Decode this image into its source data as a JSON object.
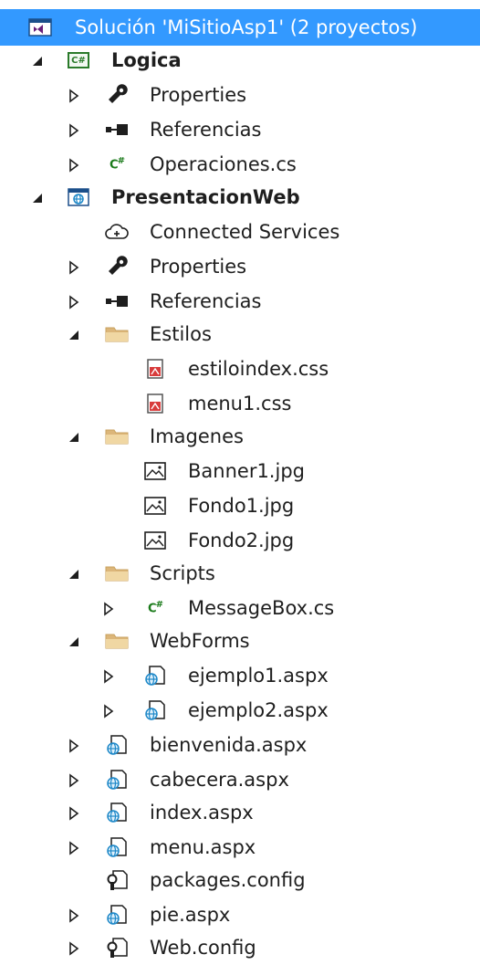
{
  "solution": {
    "label": "Solución 'MiSitioAsp1'  (2 proyectos)"
  },
  "items": [
    {
      "label": "Logica",
      "icon": "csharp-project-icon",
      "expander": "expanded"
    },
    {
      "label": "Properties",
      "icon": "wrench-icon",
      "expander": "collapsed"
    },
    {
      "label": "Referencias",
      "icon": "references-icon",
      "expander": "collapsed"
    },
    {
      "label": "Operaciones.cs",
      "icon": "csharp-file-icon",
      "expander": "collapsed"
    },
    {
      "label": "PresentacionWeb",
      "icon": "web-project-icon",
      "expander": "expanded"
    },
    {
      "label": "Connected Services",
      "icon": "connected-services-icon",
      "expander": "none"
    },
    {
      "label": "Properties",
      "icon": "wrench-icon",
      "expander": "collapsed"
    },
    {
      "label": "Referencias",
      "icon": "references-icon",
      "expander": "collapsed"
    },
    {
      "label": "Estilos",
      "icon": "folder-icon",
      "expander": "expanded"
    },
    {
      "label": "estiloindex.css",
      "icon": "css-file-icon",
      "expander": "none"
    },
    {
      "label": "menu1.css",
      "icon": "css-file-icon",
      "expander": "none"
    },
    {
      "label": "Imagenes",
      "icon": "folder-icon",
      "expander": "expanded"
    },
    {
      "label": "Banner1.jpg",
      "icon": "image-file-icon",
      "expander": "none"
    },
    {
      "label": "Fondo1.jpg",
      "icon": "image-file-icon",
      "expander": "none"
    },
    {
      "label": "Fondo2.jpg",
      "icon": "image-file-icon",
      "expander": "none"
    },
    {
      "label": "Scripts",
      "icon": "folder-icon",
      "expander": "expanded"
    },
    {
      "label": "MessageBox.cs",
      "icon": "csharp-file-icon",
      "expander": "collapsed"
    },
    {
      "label": "WebForms",
      "icon": "folder-icon",
      "expander": "expanded"
    },
    {
      "label": "ejemplo1.aspx",
      "icon": "aspx-file-icon",
      "expander": "collapsed"
    },
    {
      "label": "ejemplo2.aspx",
      "icon": "aspx-file-icon",
      "expander": "collapsed"
    },
    {
      "label": "bienvenida.aspx",
      "icon": "aspx-file-icon",
      "expander": "collapsed"
    },
    {
      "label": "cabecera.aspx",
      "icon": "aspx-file-icon",
      "expander": "collapsed"
    },
    {
      "label": "index.aspx",
      "icon": "aspx-file-icon",
      "expander": "collapsed"
    },
    {
      "label": "menu.aspx",
      "icon": "aspx-file-icon",
      "expander": "collapsed"
    },
    {
      "label": "packages.config",
      "icon": "config-file-icon",
      "expander": "none"
    },
    {
      "label": "pie.aspx",
      "icon": "aspx-file-icon",
      "expander": "collapsed"
    },
    {
      "label": "Web.config",
      "icon": "config-file-icon",
      "expander": "collapsed"
    }
  ],
  "colors": {
    "selection": "#3399ff",
    "folder": "#dcb67a",
    "csharp": "#1a7a1a",
    "web": "#1e88c8",
    "vs_purple": "#68217a"
  }
}
